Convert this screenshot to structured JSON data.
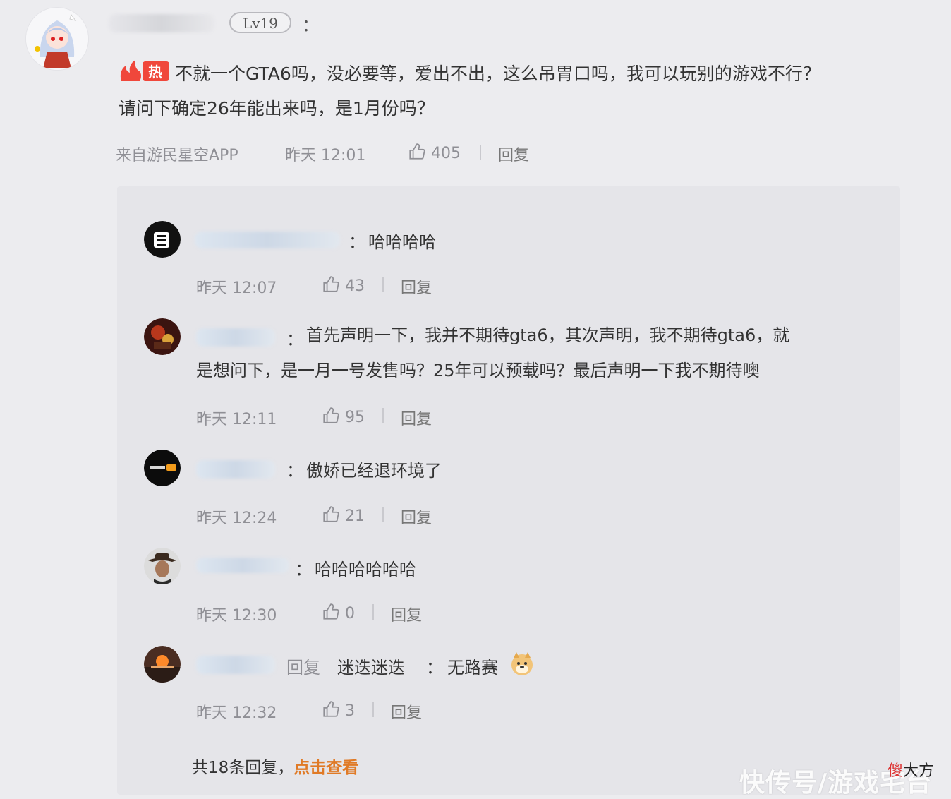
{
  "comment": {
    "level_badge": "Lv19",
    "colon": "：",
    "hot_label": "热",
    "text_line1": "不就一个GTA6吗，没必要等，爱出不出，这么吊胃口吗，我可以玩别的游戏不行？",
    "text_line2": "请问下确定26年能出来吗，是1月份吗？",
    "source": "来自游民星空APP",
    "time": "昨天 12:01",
    "likes": "405",
    "reply_label": "回复"
  },
  "replies": [
    {
      "colon": "：",
      "text": "哈哈哈哈",
      "time": "昨天 12:07",
      "likes": "43",
      "reply_label": "回复"
    },
    {
      "colon": "：",
      "text_line1": "首先声明一下，我并不期待gta6，其次声明，我不期待gta6，就",
      "text_line2": "是想问下，是一月一号发售吗？25年可以预载吗？最后声明一下我不期待噢",
      "time": "昨天 12:11",
      "likes": "95",
      "reply_label": "回复"
    },
    {
      "colon": "：",
      "text": "傲娇已经退环境了",
      "time": "昨天 12:24",
      "likes": "21",
      "reply_label": "回复"
    },
    {
      "colon": "：",
      "text": "哈哈哈哈哈哈",
      "time": "昨天 12:30",
      "likes": "0",
      "reply_label": "回复"
    },
    {
      "reply_word": "回复",
      "target": "迷迭迷迭",
      "colon": "：",
      "text": "无路赛",
      "time": "昨天 12:32",
      "likes": "3",
      "reply_label": "回复"
    }
  ],
  "footer": {
    "count_text": "共18条回复，",
    "view_link": "点击查看"
  },
  "watermark": {
    "text": "快传号/游戏宅台",
    "author_first": "傻",
    "author_rest": "大方"
  },
  "colors": {
    "background": "#ececef",
    "reply_panel": "#e5e5e9",
    "hot_badge": "#f0473b",
    "link": "#e07a26",
    "meta": "#8f8f95"
  }
}
